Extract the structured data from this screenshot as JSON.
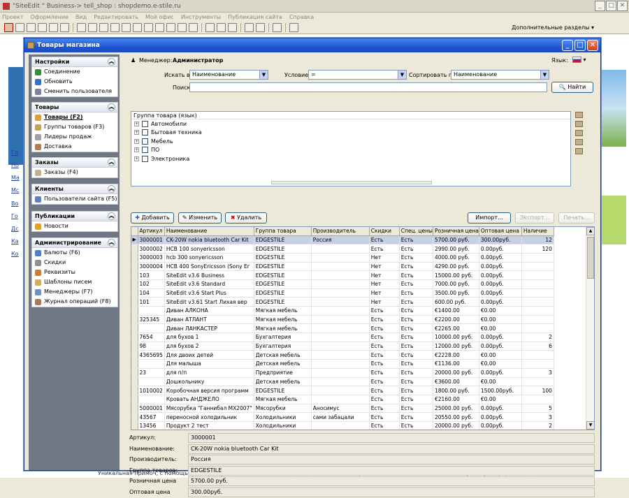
{
  "app": {
    "title": "\"SiteEdit \" Business-> tell_shop : shopdemo.e-stile.ru",
    "menu": [
      "Проект",
      "Оформление",
      "Вид",
      "Редактировать",
      "Мой офис",
      "Инструменты",
      "Публикация сайта",
      "Справка"
    ],
    "extra_sections": "Дополнительные разделы"
  },
  "background": {
    "links": [
      "Гл",
      "Но",
      "Ма",
      "Мс",
      "Во",
      "Го",
      "Дс",
      "Ка",
      "Ко"
    ],
    "bottom_text": "Уникальная примоч, с помощью которых уходимые на земли владельцев сотовых телефонов. Советы, как не попасться на уловку к аферистам, дает"
  },
  "dialog": {
    "title": "Товары магазина"
  },
  "sidebar": {
    "groups": [
      {
        "title": "Настройки",
        "items": [
          "Соединение",
          "Обновить",
          "Сменить пользователя"
        ]
      },
      {
        "title": "Товары",
        "items": [
          "Товары (F2)",
          "Группы товаров (F3)",
          "Лидеры продаж",
          "Доставка"
        ]
      },
      {
        "title": "Заказы",
        "items": [
          "Заказы (F4)"
        ]
      },
      {
        "title": "Клиенты",
        "items": [
          "Пользователи сайта (F5)"
        ]
      },
      {
        "title": "Публикации",
        "items": [
          "Новости"
        ]
      },
      {
        "title": "Администрирование",
        "items": [
          "Валюты (F6)",
          "Скидки",
          "Реквизиты",
          "Шаблоны писем",
          "Менеджеры (F7)",
          "Журнал операций (F8)"
        ]
      }
    ]
  },
  "manager": {
    "label": "Менеджер:",
    "name": "Администратор",
    "lang_label": "Язык:"
  },
  "search": {
    "in_label": "Искать в:",
    "in_value": "Наименование",
    "cond_label": "Условие:",
    "cond_value": "=",
    "sort_label": "Сортировать по:",
    "sort_value": "Наименование",
    "query_label": "Поиск:",
    "query_value": "",
    "find_button": "Найти"
  },
  "tree": {
    "header": "Группа товара (язык)",
    "nodes": [
      "Автомобили",
      "Бытовая техника",
      "Мебель",
      "ПО",
      "Электроника"
    ]
  },
  "actions": {
    "add": "Добавить",
    "edit": "Изменить",
    "delete": "Удалить",
    "import": "Импорт...",
    "export": "Экспорт...",
    "print": "Печать..."
  },
  "table": {
    "columns": [
      "Артикул",
      "Наименование",
      "Группа товара",
      "Производитель",
      "Скидки",
      "Спец. цены",
      "Розничная цена",
      "Оптовая цена",
      "Наличие"
    ],
    "rows": [
      [
        "3000001",
        "CK-20W nokia bluetooth Car Kit",
        "EDGESTILE",
        "Россия",
        "Есть",
        "Есть",
        "5700.00 руб.",
        "300.00руб.",
        "12"
      ],
      [
        "3000002",
        "НСВ 100 sonyericsson",
        "EDGESTILE",
        "",
        "Есть",
        "Есть",
        "2990.00 руб.",
        "0.00руб.",
        "120"
      ],
      [
        "3000003",
        "hcb 300 sonyericsson",
        "EDGESTILE",
        "",
        "Нет",
        "Есть",
        "4000.00 руб.",
        "0.00руб.",
        ""
      ],
      [
        "3000004",
        "НСВ 400 SonyEricsson (Sony Er",
        "EDGESTILE",
        "",
        "Нет",
        "Есть",
        "4290.00 руб.",
        "0.00руб.",
        ""
      ],
      [
        "103",
        "SiteEdit v3.6 Business",
        "EDGESTILE",
        "",
        "Нет",
        "Есть",
        "15000.00 руб.",
        "0.00руб.",
        ""
      ],
      [
        "102",
        "SiteEdit v3.6 Standard",
        "EDGESTILE",
        "",
        "Нет",
        "Есть",
        "7000.00 руб.",
        "0.00руб.",
        ""
      ],
      [
        "104",
        "SiteEdit v3.6 Start Plus",
        "EDGESTILE",
        "",
        "Нет",
        "Есть",
        "3500.00 руб.",
        "0.00руб.",
        ""
      ],
      [
        "101",
        "SiteEdit v3.61 Start Лихая вер",
        "EDGESTILE",
        "",
        "Нет",
        "Есть",
        "600.00 руб.",
        "0.00руб.",
        ""
      ],
      [
        "",
        "Диван АЛКОНА",
        "Мягкая мебель",
        "",
        "Есть",
        "Есть",
        "€1400.00",
        "€0.00",
        ""
      ],
      [
        "325345",
        "Диван АТЛАНТ",
        "Мягкая мебель",
        "",
        "Есть",
        "Есть",
        "€2200.00",
        "€0.00",
        ""
      ],
      [
        "",
        "Диван ЛАНКАСТЕР",
        "Мягкая мебель",
        "",
        "Есть",
        "Есть",
        "€2265.00",
        "€0.00",
        ""
      ],
      [
        "7654",
        "для бухов 1",
        "Бухгалтерия",
        "",
        "Есть",
        "Есть",
        "10000.00 руб.",
        "0.00руб.",
        "2"
      ],
      [
        "98",
        "для бухов 2",
        "Бухгалтерия",
        "",
        "Есть",
        "Есть",
        "12000.00 руб.",
        "0.00руб.",
        "6"
      ],
      [
        "4365695",
        "Для двоих детей",
        "Детская мебель",
        "",
        "Есть",
        "Есть",
        "€2228.00",
        "€0.00",
        ""
      ],
      [
        "",
        "Для малыша",
        "Детская мебель",
        "",
        "Есть",
        "Есть",
        "€1136.00",
        "€0.00",
        ""
      ],
      [
        "23",
        "для п/п",
        "Предприятие",
        "",
        "Есть",
        "Есть",
        "20000.00 руб.",
        "0.00руб.",
        "3"
      ],
      [
        "",
        "Дошкольнику",
        "Детская мебель",
        "",
        "Есть",
        "Есть",
        "€3600.00",
        "€0.00",
        ""
      ],
      [
        "1010002",
        "Коробочная версия программ",
        "EDGESTILE",
        "",
        "Есть",
        "Есть",
        "1800.00 руб.",
        "1500.00руб.",
        "100"
      ],
      [
        "",
        "Кровать АНДЖЕЛО",
        "Мягкая мебель",
        "",
        "Есть",
        "Есть",
        "€2160.00",
        "€0.00",
        ""
      ],
      [
        "5000001",
        "Мясорубка \"Ганнибал МХ2007\"",
        "Мясорубки",
        "Аносимус",
        "Есть",
        "Есть",
        "25000.00 руб.",
        "0.00руб.",
        "5"
      ],
      [
        "43567",
        "переносной холодильник",
        "Холодильники",
        "сами забацали",
        "Есть",
        "Есть",
        "20550.00 руб.",
        "0.00руб.",
        "3"
      ],
      [
        "13456",
        "Продукт 2 тест",
        "Холодильники",
        "",
        "Есть",
        "Есть",
        "20000.00 руб.",
        "0.00руб.",
        "2"
      ]
    ]
  },
  "details": [
    {
      "label": "Артикул:",
      "value": "3000001"
    },
    {
      "label": "Наименование:",
      "value": "CK-20W nokia bluetooth Car Kit"
    },
    {
      "label": "Производитель:",
      "value": "Россия"
    },
    {
      "label": "Группа товаров:",
      "value": "EDGESTILE"
    },
    {
      "label": "Розничная цена",
      "value": "5700.00 руб."
    },
    {
      "label": "Оптовая цена",
      "value": "300.00руб."
    }
  ]
}
